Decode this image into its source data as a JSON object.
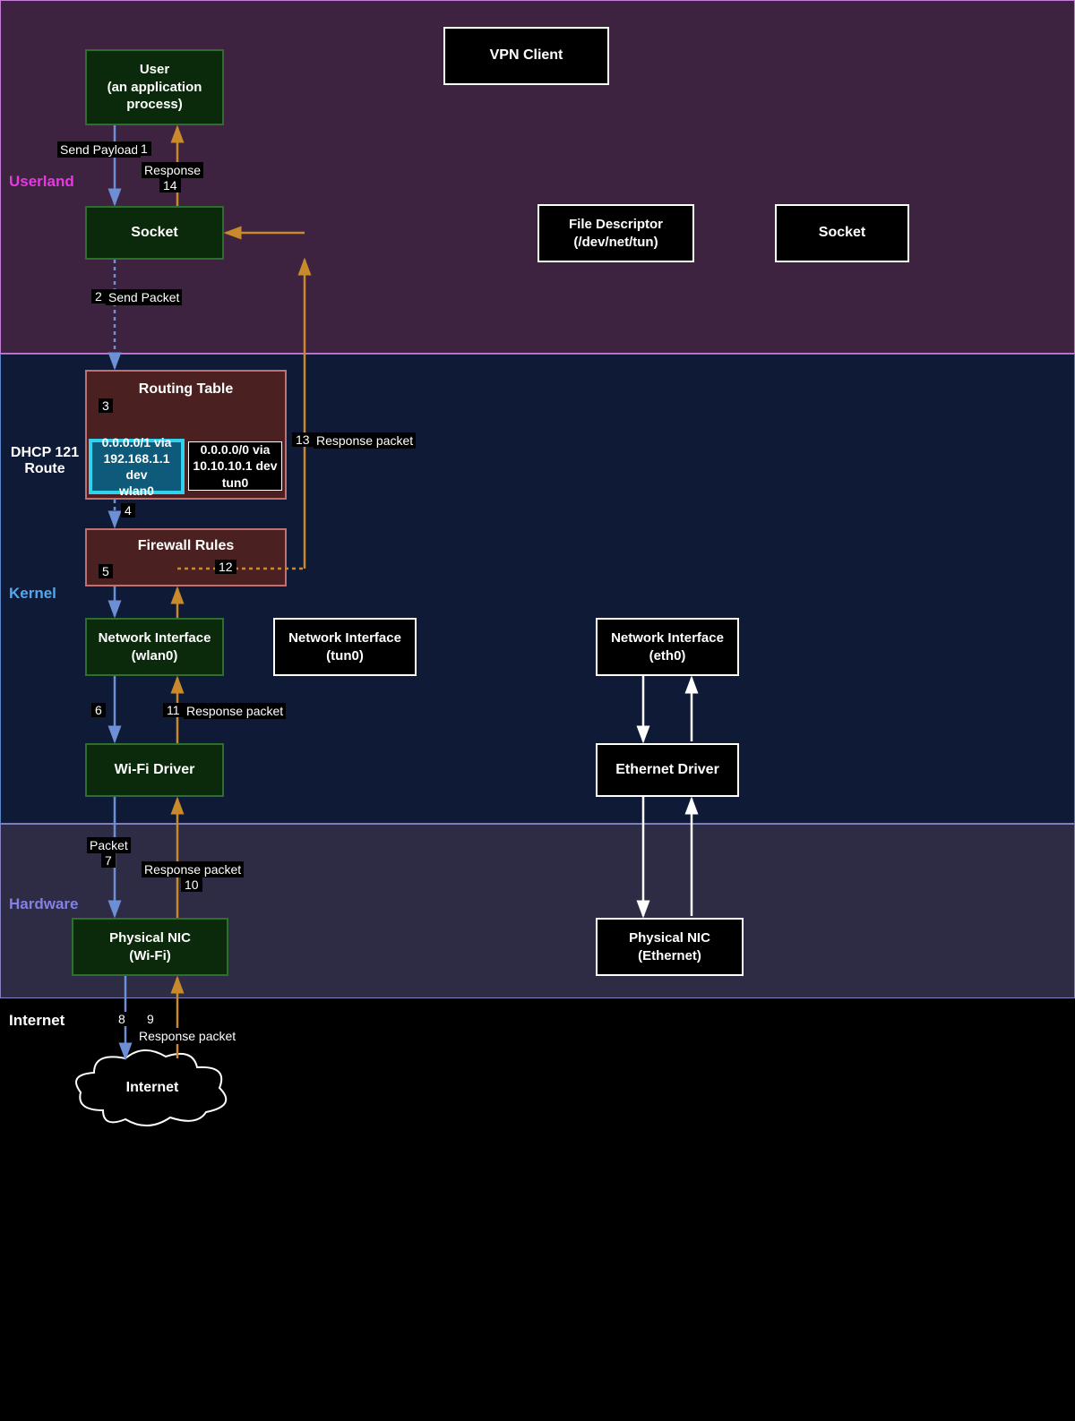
{
  "layers": {
    "userland": "Userland",
    "kernel": "Kernel",
    "hardware": "Hardware",
    "internet": "Internet"
  },
  "side_label": "DHCP 121\nRoute",
  "nodes": {
    "user": "User\n(an application\nprocess)",
    "socket_left": "Socket",
    "vpn_client": "VPN Client",
    "file_descriptor": "File Descriptor\n(/dev/net/tun)",
    "socket_right": "Socket",
    "routing_table": "Routing Table",
    "route_active": "0.0.0.0/1 via\n192.168.1.1 dev\nwlan0",
    "route_inactive": "0.0.0.0/0 via\n10.10.10.1 dev\ntun0",
    "firewall": "Firewall Rules",
    "if_wlan0": "Network Interface\n(wlan0)",
    "if_tun0": "Network Interface\n(tun0)",
    "if_eth0": "Network Interface\n(eth0)",
    "wifi_driver": "Wi-Fi Driver",
    "eth_driver": "Ethernet Driver",
    "nic_wifi": "Physical NIC\n(Wi-Fi)",
    "nic_eth": "Physical NIC\n(Ethernet)",
    "internet_cloud": "Internet"
  },
  "edges": {
    "e1": "Send Payload",
    "e2": "Send Packet",
    "e6": "",
    "e7": "Packet",
    "e8": "",
    "e9": "Response packet",
    "e10": "Response packet",
    "e11": "Response packet",
    "e13": "Response packet",
    "e14": "Response"
  },
  "steps": {
    "s1": "1",
    "s2": "2",
    "s3": "3",
    "s4": "4",
    "s5": "5",
    "s6": "6",
    "s7": "7",
    "s8": "8",
    "s9": "9",
    "s10": "10",
    "s11": "11",
    "s12": "12",
    "s13": "13",
    "s14": "14"
  },
  "colors": {
    "arrow_down": "#6d8fd6",
    "arrow_up": "#c98a2c"
  }
}
